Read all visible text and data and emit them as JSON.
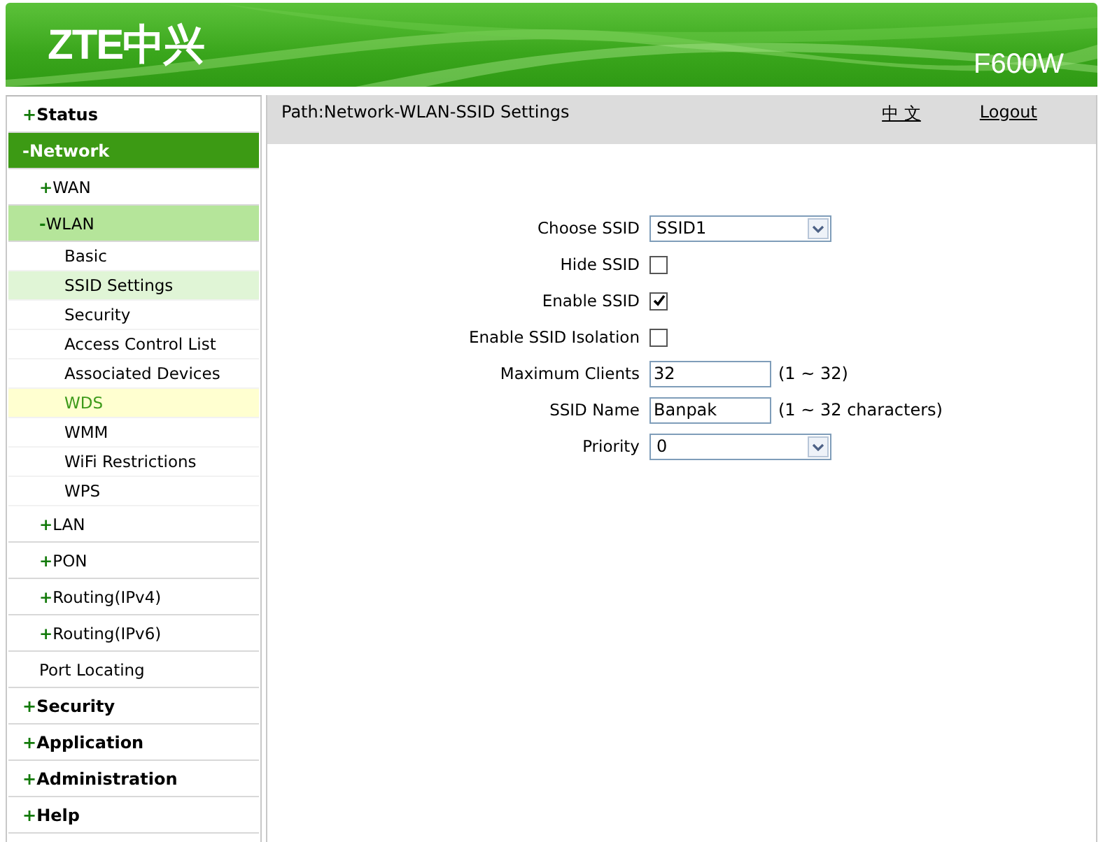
{
  "header": {
    "logo": "ZTE中兴",
    "model": "F600W"
  },
  "path": "Path:Network-WLAN-SSID Settings",
  "language_link": "中 文",
  "logout_link": "Logout",
  "nav": [
    {
      "sign": "+",
      "label": "Status",
      "selected": false
    },
    {
      "sign": "-",
      "label": "Network",
      "selected": true,
      "children": [
        {
          "sign": "+",
          "label": "WAN",
          "selected": false
        },
        {
          "sign": "-",
          "label": "WLAN",
          "selected": true,
          "children": [
            {
              "label": "Basic",
              "selected": false,
              "hovered": false
            },
            {
              "label": "SSID Settings",
              "selected": true,
              "hovered": false
            },
            {
              "label": "Security",
              "selected": false,
              "hovered": false
            },
            {
              "label": "Access Control List",
              "selected": false,
              "hovered": false
            },
            {
              "label": "Associated Devices",
              "selected": false,
              "hovered": false
            },
            {
              "label": "WDS",
              "selected": false,
              "hovered": true
            },
            {
              "label": "WMM",
              "selected": false,
              "hovered": false
            },
            {
              "label": "WiFi Restrictions",
              "selected": false,
              "hovered": false
            },
            {
              "label": "WPS",
              "selected": false,
              "hovered": false
            }
          ]
        },
        {
          "sign": "+",
          "label": "LAN",
          "selected": false
        },
        {
          "sign": "+",
          "label": "PON",
          "selected": false
        },
        {
          "sign": "+",
          "label": "Routing(IPv4)",
          "selected": false
        },
        {
          "sign": "+",
          "label": "Routing(IPv6)",
          "selected": false
        },
        {
          "label": "Port Locating",
          "selected": false
        }
      ]
    },
    {
      "sign": "+",
      "label": "Security",
      "selected": false
    },
    {
      "sign": "+",
      "label": "Application",
      "selected": false
    },
    {
      "sign": "+",
      "label": "Administration",
      "selected": false
    },
    {
      "sign": "+",
      "label": "Help",
      "selected": false
    }
  ],
  "form": [
    {
      "kind": "select",
      "label": "Choose SSID",
      "value": "SSID1"
    },
    {
      "kind": "checkbox",
      "label": "Hide SSID",
      "checked": false
    },
    {
      "kind": "checkbox",
      "label": "Enable SSID",
      "checked": true
    },
    {
      "kind": "checkbox",
      "label": "Enable SSID Isolation",
      "checked": false
    },
    {
      "kind": "text",
      "label": "Maximum Clients",
      "value": "32",
      "hint": "(1 ~ 32)"
    },
    {
      "kind": "text",
      "label": "SSID Name",
      "value": "Banpak",
      "hint": "(1 ~ 32 characters)"
    },
    {
      "kind": "select",
      "label": "Priority",
      "value": "0"
    }
  ]
}
